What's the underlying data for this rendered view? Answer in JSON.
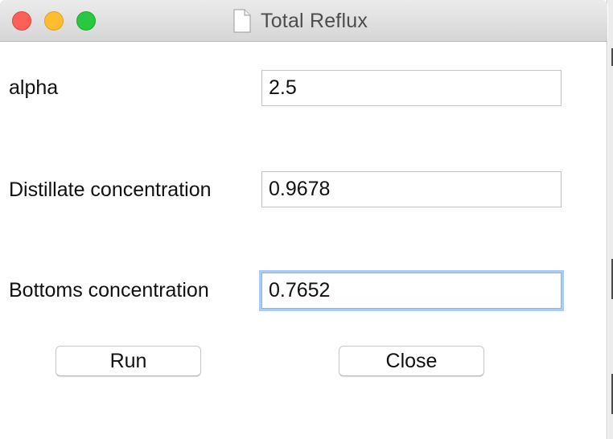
{
  "window": {
    "title": "Total Reflux",
    "title_icon": "document-icon",
    "controls": [
      "close",
      "minimize",
      "zoom"
    ]
  },
  "form": {
    "fields": [
      {
        "label": "alpha",
        "value": "2.5"
      },
      {
        "label": "Distillate concentration",
        "value": "0.9678"
      },
      {
        "label": "Bottoms concentration",
        "value": "0.7652",
        "focused": true
      }
    ]
  },
  "buttons": {
    "run_label": "Run",
    "close_label": "Close"
  },
  "colors": {
    "close_light": "#fe5f57",
    "minimize_light": "#febc2e",
    "zoom_light": "#28c840",
    "focus_ring": "#a9ccf6"
  }
}
